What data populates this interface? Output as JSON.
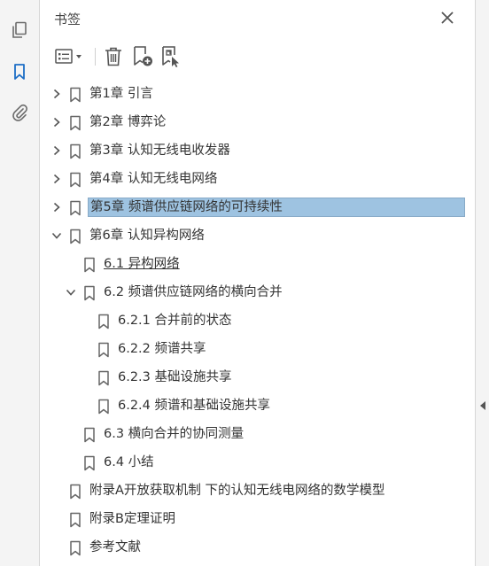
{
  "panel": {
    "title": "书签"
  },
  "rail": {
    "items": [
      {
        "icon": "pages-icon"
      },
      {
        "icon": "bookmark-icon",
        "active": true
      },
      {
        "icon": "attachment-icon"
      }
    ]
  },
  "toolbar": {
    "icons": [
      "options-menu-icon",
      "delete-icon",
      "new-bookmark-icon",
      "new-bookmark-from-selection-icon"
    ]
  },
  "colors": {
    "accent": "#1d6ec6",
    "selected_bg": "#9ec3e1",
    "icon_gray": "#6b6b6b"
  },
  "bookmarks": [
    {
      "label": "第1章 引言",
      "level": 0,
      "chevron": "right"
    },
    {
      "label": "第2章 博弈论",
      "level": 0,
      "chevron": "right"
    },
    {
      "label": "第3章 认知无线电收发器",
      "level": 0,
      "chevron": "right"
    },
    {
      "label": "第4章 认知无线电网络",
      "level": 0,
      "chevron": "right"
    },
    {
      "label": "第5章 频谱供应链网络的可持续性",
      "level": 0,
      "chevron": "right",
      "selected": true
    },
    {
      "label": "第6章 认知异构网络",
      "level": 0,
      "chevron": "down"
    },
    {
      "label": "6.1 异构网络",
      "level": 1,
      "chevron": "none",
      "underlined": true
    },
    {
      "label": "6.2 频谱供应链网络的横向合并",
      "level": 1,
      "chevron": "down"
    },
    {
      "label": "6.2.1 合并前的状态",
      "level": 2,
      "chevron": "none"
    },
    {
      "label": "6.2.2 频谱共享",
      "level": 2,
      "chevron": "none"
    },
    {
      "label": "6.2.3 基础设施共享",
      "level": 2,
      "chevron": "none"
    },
    {
      "label": "6.2.4 频谱和基础设施共享",
      "level": 2,
      "chevron": "none"
    },
    {
      "label": "6.3 横向合并的协同测量",
      "level": 1,
      "chevron": "none"
    },
    {
      "label": "6.4 小结",
      "level": 1,
      "chevron": "none"
    },
    {
      "label": "附录A开放获取机制 下的认知无线电网络的数学模型",
      "level": 0,
      "chevron": "none"
    },
    {
      "label": "附录B定理证明",
      "level": 0,
      "chevron": "none"
    },
    {
      "label": "参考文献",
      "level": 0,
      "chevron": "none"
    }
  ]
}
